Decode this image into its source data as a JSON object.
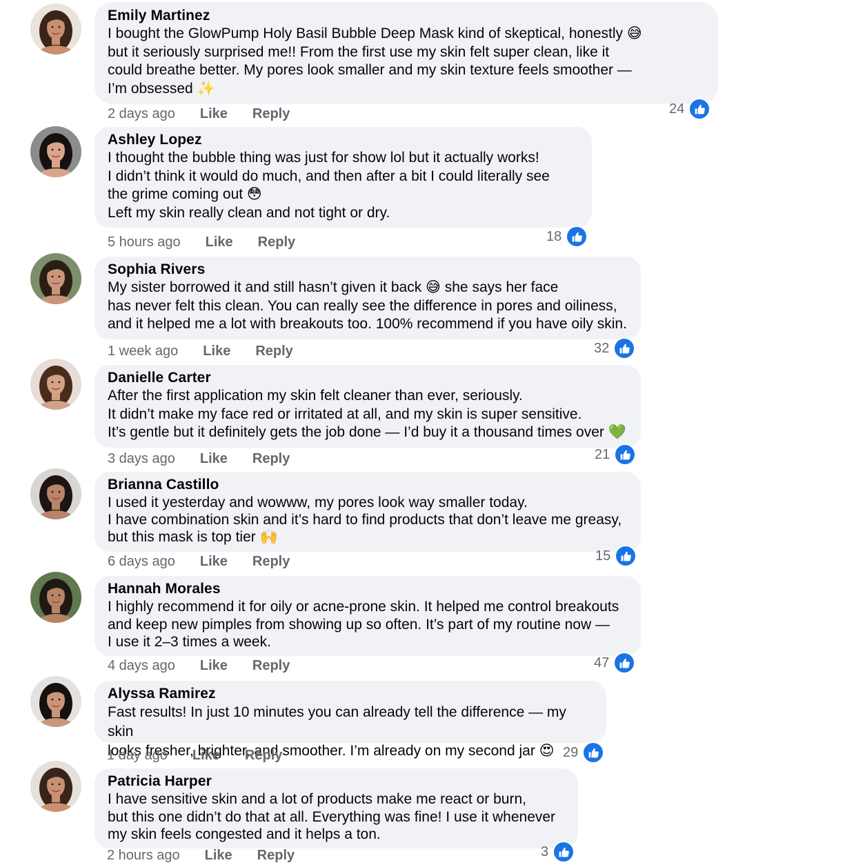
{
  "colors": {
    "bubble_bg": "#f0f2f5",
    "meta_text": "#65676b",
    "like_blue": "#1b74e4"
  },
  "comments": [
    {
      "name": "Emily Martinez",
      "text": "I bought the GlowPump Holy Basil Bubble Deep Mask kind of skeptical, honestly 😅\nbut it seriously surprised me!! From the first use my skin felt super clean, like it\ncould breathe better. My pores look smaller and my skin texture feels smoother —\nI’m obsessed ✨",
      "time": "2 days ago",
      "like_label": "Like",
      "reply_label": "Reply",
      "likes": "24",
      "avatar_skin": "#c98f6e",
      "avatar_hair": "#3b2418",
      "avatar_bg": "#e9e3dc"
    },
    {
      "name": "Ashley Lopez",
      "text": "I thought the bubble thing was just for show lol but it actually works!\nI didn’t think it would do much, and then after a bit I could literally see\nthe grime coming out 😳\nLeft my skin really clean and not tight or dry.",
      "time": "5 hours ago",
      "like_label": "Like",
      "reply_label": "Reply",
      "likes": "18",
      "avatar_skin": "#d9a488",
      "avatar_hair": "#141110",
      "avatar_bg": "#8c8c8c"
    },
    {
      "name": "Sophia Rivers",
      "text": "My sister borrowed it and still hasn’t given it back 😅 she says her face\nhas never felt this clean. You can really see the difference in pores and oiliness,\nand it helped me a lot with breakouts too. 100% recommend if you have oily skin.",
      "time": "1 week ago",
      "like_label": "Like",
      "reply_label": "Reply",
      "likes": "32",
      "avatar_skin": "#c99679",
      "avatar_hair": "#2a1d16",
      "avatar_bg": "#7d8f6a"
    },
    {
      "name": "Danielle Carter",
      "text": "After the first application my skin felt cleaner than ever, seriously.\nIt didn’t make my face red or irritated at all, and my skin is super sensitive.\nIt’s gentle but it definitely gets the job done — I’d buy it a thousand times over 💚",
      "time": "3 days ago",
      "like_label": "Like",
      "reply_label": "Reply",
      "likes": "21",
      "avatar_skin": "#d2a287",
      "avatar_hair": "#4a2c1c",
      "avatar_bg": "#e6ddd6"
    },
    {
      "name": "Brianna Castillo",
      "text": "I used it yesterday and wowww, my pores look way smaller today.\nI have combination skin and it’s hard to find products that don’t leave me greasy,\nbut this mask is top tier 🙌",
      "time": "6 days ago",
      "like_label": "Like",
      "reply_label": "Reply",
      "likes": "15",
      "avatar_skin": "#b98468",
      "avatar_hair": "#1c1512",
      "avatar_bg": "#d8d5d2"
    },
    {
      "name": "Hannah Morales",
      "text": "I highly recommend it for oily or acne-prone skin. It helped me control breakouts\nand keep new pimples from showing up so often. It’s part of my routine now —\nI use it 2–3 times a week.",
      "time": "4 days ago",
      "like_label": "Like",
      "reply_label": "Reply",
      "likes": "47",
      "avatar_skin": "#b88466",
      "avatar_hair": "#1f1915",
      "avatar_bg": "#5f7a4e"
    },
    {
      "name": "Alyssa Ramirez",
      "text": "Fast results! In just 10 minutes you can already tell the difference — my skin\nlooks fresher, brighter, and smoother. I’m already on my second jar 😍",
      "time": "1 day ago",
      "like_label": "Like",
      "reply_label": "Reply",
      "likes": "29",
      "avatar_skin": "#c9967a",
      "avatar_hair": "#15110f",
      "avatar_bg": "#e4e2e0"
    },
    {
      "name": "Patricia Harper",
      "text": "I have sensitive skin and a lot of products make me react or burn,\nbut this one didn’t do that at all. Everything was fine! I use it whenever\nmy skin feels congested and it helps a ton.",
      "time": "2 hours ago",
      "like_label": "Like",
      "reply_label": "Reply",
      "likes": "3",
      "avatar_skin": "#c99173",
      "avatar_hair": "#3a2419",
      "avatar_bg": "#e5e0db"
    }
  ]
}
